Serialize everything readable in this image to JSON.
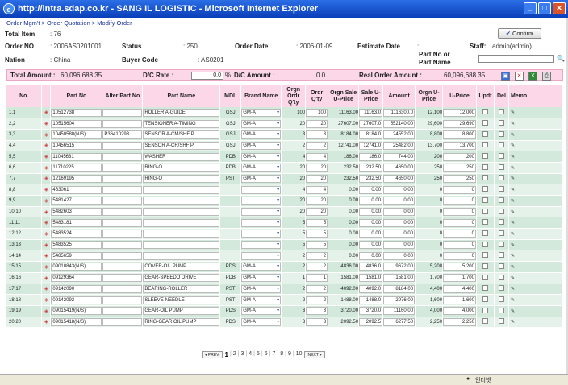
{
  "window": {
    "title": "http://intra.sdap.co.kr - SANG IL LOGISTIC - Microsoft Internet Explorer"
  },
  "breadcrumb": "Order Mgm't > Order Quotation > Modify Order",
  "info": {
    "total_item_label": "Total Item",
    "total_item_value": "76",
    "order_no_label": "Order NO",
    "order_no_value": "2006AS0201001",
    "status_label": "Status",
    "status_value": "250",
    "order_date_label": "Order Date",
    "order_date_value": "2006-01-09",
    "estimate_date_label": "Estimate Date",
    "estimate_date_value": "",
    "staff_label": "Staff:",
    "staff_value": "admin(admin)",
    "nation_label": "Nation",
    "nation_value": "China",
    "buyer_code_label": "Buyer Code",
    "buyer_code_value": "AS0201",
    "partno_label1": "Part No or",
    "partno_label2": "Part Name",
    "confirm_label": "Confirm"
  },
  "totals": {
    "total_amount_label": "Total Amount :",
    "total_amount_value": "60,096,688.35",
    "dc_rate_label": "D/C Rate :",
    "dc_rate_value": "0.0",
    "percent": "%",
    "dc_amount_label": "D/C Amount :",
    "dc_amount_value": "0.0",
    "real_amount_label": "Real Order Amount :",
    "real_amount_value": "60,096,688.35"
  },
  "columns": [
    "No.",
    "",
    "Part No",
    "Alter Part No",
    "Part Name",
    "MDL",
    "Brand Name",
    "Orgn Ordr Q'ty",
    "Ordr Q'ty",
    "Orgn Sale U-Price",
    "Sale U-Price",
    "Amount",
    "Orgn U-Price",
    "U-Price",
    "Updt",
    "Del",
    "Memo"
  ],
  "rows": [
    {
      "no": "1,1",
      "part": "10512738",
      "alt": "",
      "name": "ROLLER A-GUIDE",
      "mdl": "GSJ",
      "brand": "GM-A",
      "oq": "100",
      "q": "100",
      "osp": "11163.00",
      "sp": "11163.0",
      "amt": "1116300.0",
      "ou": "12,100",
      "u": "12,000"
    },
    {
      "no": "2,2",
      "part": "10515604",
      "alt": "",
      "name": "TENSIONER A-TIMING",
      "mdl": "GSJ",
      "brand": "GM-A",
      "oq": "20",
      "q": "20",
      "osp": "27607.00",
      "sp": "27607.0",
      "amt": "552140.00",
      "ou": "29,600",
      "u": "29,690"
    },
    {
      "no": "3,3",
      "part": "10450580(N/S)",
      "alt": "P36410293",
      "name": "SENSOR A-CM/SHF P",
      "mdl": "GSJ",
      "brand": "GM-A",
      "oq": "3",
      "q": "3",
      "osp": "8184.00",
      "sp": "8184.0",
      "amt": "24552.00",
      "ou": "8,800",
      "u": "8,800"
    },
    {
      "no": "4,4",
      "part": "10456515",
      "alt": "",
      "name": "SENSOR A-CR/SHF P",
      "mdl": "GSJ",
      "brand": "GM-A",
      "oq": "2",
      "q": "2",
      "osp": "12741.00",
      "sp": "12741.0",
      "amt": "25482.00",
      "ou": "13,700",
      "u": "13,700"
    },
    {
      "no": "5,5",
      "part": "11045631",
      "alt": "",
      "name": "WASHER",
      "mdl": "PDB",
      "brand": "GM-A",
      "oq": "4",
      "q": "4",
      "osp": "186.00",
      "sp": "186.0",
      "amt": "744.00",
      "ou": "200",
      "u": "200"
    },
    {
      "no": "6,6",
      "part": "11710225",
      "alt": "",
      "name": "RING-O",
      "mdl": "PDB",
      "brand": "GM-A",
      "oq": "20",
      "q": "20",
      "osp": "232.50",
      "sp": "232.50",
      "amt": "4650.00",
      "ou": "250",
      "u": "250"
    },
    {
      "no": "7,7",
      "part": "12169195",
      "alt": "",
      "name": "RING-O",
      "mdl": "PST",
      "brand": "GM-A",
      "oq": "20",
      "q": "20",
      "osp": "232.50",
      "sp": "232.50",
      "amt": "4650.00",
      "ou": "250",
      "u": "250"
    },
    {
      "no": "8,8",
      "part": "463061",
      "alt": "",
      "name": "",
      "mdl": "",
      "brand": "",
      "oq": "4",
      "q": "4",
      "osp": "0.00",
      "sp": "0.00",
      "amt": "0.00",
      "ou": "0",
      "u": "0"
    },
    {
      "no": "9,9",
      "part": "5481427",
      "alt": "",
      "name": "",
      "mdl": "",
      "brand": "",
      "oq": "20",
      "q": "20",
      "osp": "0.00",
      "sp": "0.00",
      "amt": "0.00",
      "ou": "0",
      "u": "0"
    },
    {
      "no": "10,10",
      "part": "5482603",
      "alt": "",
      "name": "",
      "mdl": "",
      "brand": "",
      "oq": "20",
      "q": "20",
      "osp": "0.00",
      "sp": "0.00",
      "amt": "0.00",
      "ou": "0",
      "u": "0"
    },
    {
      "no": "11,11",
      "part": "5483181",
      "alt": "",
      "name": "",
      "mdl": "",
      "brand": "",
      "oq": "5",
      "q": "5",
      "osp": "0.00",
      "sp": "0.00",
      "amt": "0.00",
      "ou": "0",
      "u": "0"
    },
    {
      "no": "12,12",
      "part": "5483524",
      "alt": "",
      "name": "",
      "mdl": "",
      "brand": "",
      "oq": "5",
      "q": "5",
      "osp": "0.00",
      "sp": "0.00",
      "amt": "0.00",
      "ou": "0",
      "u": "0"
    },
    {
      "no": "13,13",
      "part": "5483525",
      "alt": "",
      "name": "",
      "mdl": "",
      "brand": "",
      "oq": "5",
      "q": "5",
      "osp": "0.00",
      "sp": "0.00",
      "amt": "0.00",
      "ou": "0",
      "u": "0"
    },
    {
      "no": "14,14",
      "part": "5485659",
      "alt": "",
      "name": "",
      "mdl": "",
      "brand": "",
      "oq": "2",
      "q": "2",
      "osp": "0.00",
      "sp": "0.00",
      "amt": "0.00",
      "ou": "0",
      "u": "0"
    },
    {
      "no": "15,15",
      "part": "09010843(N/S)",
      "alt": "",
      "name": "COVER-OIL PUMP",
      "mdl": "PDS",
      "brand": "GM-A",
      "oq": "2",
      "q": "2",
      "osp": "4836.00",
      "sp": "4836.0",
      "amt": "9672.00",
      "ou": "5,200",
      "u": "5,200"
    },
    {
      "no": "16,16",
      "part": "09129364",
      "alt": "",
      "name": "GEAR-SPEEDO DRIVE",
      "mdl": "PDB",
      "brand": "GM-A",
      "oq": "1",
      "q": "1",
      "osp": "1581.00",
      "sp": "1581.0",
      "amt": "1581.00",
      "ou": "1,700",
      "u": "1,700"
    },
    {
      "no": "17,17",
      "part": "09142090",
      "alt": "",
      "name": "BEARING-ROLLER",
      "mdl": "PST",
      "brand": "GM-A",
      "oq": "2",
      "q": "2",
      "osp": "4092.00",
      "sp": "4092.0",
      "amt": "8184.00",
      "ou": "4,400",
      "u": "4,400"
    },
    {
      "no": "18,18",
      "part": "09142092",
      "alt": "",
      "name": "SLEEVE-NEEDLE",
      "mdl": "PST",
      "brand": "GM-A",
      "oq": "2",
      "q": "2",
      "osp": "1488.00",
      "sp": "1488.0",
      "amt": "2976.00",
      "ou": "1,600",
      "u": "1,600"
    },
    {
      "no": "19,19",
      "part": "09015419(N/S)",
      "alt": "",
      "name": "GEAR-OIL PUMP",
      "mdl": "PDS",
      "brand": "GM-A",
      "oq": "3",
      "q": "3",
      "osp": "3720.00",
      "sp": "3720.0",
      "amt": "11160.00",
      "ou": "4,000",
      "u": "4,000"
    },
    {
      "no": "20,20",
      "part": "09015418(N/S)",
      "alt": "",
      "name": "RING-GEAR,OIL PUMP",
      "mdl": "PDS",
      "brand": "GM-A",
      "oq": "3",
      "q": "3",
      "osp": "2092.50",
      "sp": "2092.5",
      "amt": "6277.50",
      "ou": "2,250",
      "u": "2,250"
    }
  ],
  "pager": {
    "prev": "◂ PREV",
    "next": "NEXT ▸",
    "pages": [
      "1",
      "2",
      "3",
      "4",
      "5",
      "6",
      "7",
      "8",
      "9",
      "10"
    ],
    "current": "1"
  },
  "status": {
    "zone": "인터넷"
  }
}
